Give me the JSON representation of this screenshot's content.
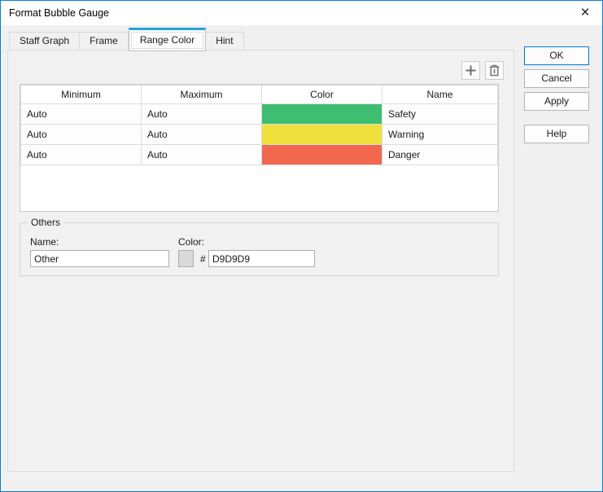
{
  "window": {
    "title": "Format Bubble Gauge",
    "close_glyph": "×"
  },
  "tabs": [
    {
      "label": "Staff Graph",
      "active": false
    },
    {
      "label": "Frame",
      "active": false
    },
    {
      "label": "Range Color",
      "active": true
    },
    {
      "label": "Hint",
      "active": false
    }
  ],
  "toolbar": {
    "add_icon": "plus-icon",
    "delete_icon": "trash-icon"
  },
  "range_table": {
    "columns": [
      "Minimum",
      "Maximum",
      "Color",
      "Name"
    ],
    "rows": [
      {
        "minimum": "Auto",
        "maximum": "Auto",
        "color": "#3dbe71",
        "name": "Safety"
      },
      {
        "minimum": "Auto",
        "maximum": "Auto",
        "color": "#f0e03c",
        "name": "Warning"
      },
      {
        "minimum": "Auto",
        "maximum": "Auto",
        "color": "#f2674e",
        "name": "Danger"
      }
    ]
  },
  "others": {
    "group_label": "Others",
    "name_label": "Name:",
    "name_value": "Other",
    "color_label": "Color:",
    "hash_symbol": "#",
    "color_value": "D9D9D9",
    "swatch_color": "#d9d9d9"
  },
  "action_buttons": {
    "ok": "OK",
    "cancel": "Cancel",
    "apply": "Apply",
    "help": "Help"
  },
  "colors": {
    "accent_border": "#0b7bd7",
    "tab_highlight": "#23a2de"
  }
}
